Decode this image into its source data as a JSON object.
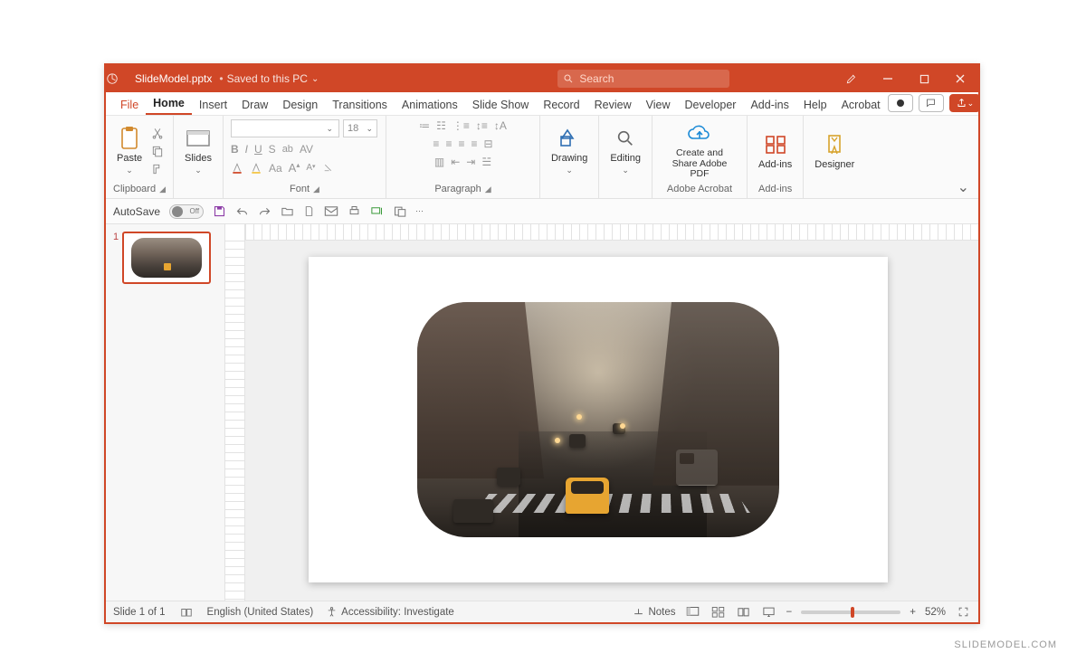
{
  "title": {
    "filename": "SlideModel.pptx",
    "save_state": "Saved to this PC"
  },
  "search": {
    "placeholder": "Search"
  },
  "tabs": {
    "file": "File",
    "home": "Home",
    "insert": "Insert",
    "draw": "Draw",
    "design": "Design",
    "transitions": "Transitions",
    "animations": "Animations",
    "slideshow": "Slide Show",
    "record": "Record",
    "review": "Review",
    "view": "View",
    "developer": "Developer",
    "addins": "Add-ins",
    "help": "Help",
    "acrobat": "Acrobat"
  },
  "ribbon": {
    "clipboard": {
      "paste": "Paste",
      "label": "Clipboard"
    },
    "slides": {
      "btn": "Slides",
      "label": ""
    },
    "font": {
      "size": "18",
      "label": "Font"
    },
    "paragraph": {
      "label": "Paragraph"
    },
    "drawing": {
      "btn": "Drawing",
      "label": ""
    },
    "editing": {
      "btn": "Editing",
      "label": ""
    },
    "acrobat": {
      "btn": "Create and Share Adobe PDF",
      "label": "Adobe Acrobat"
    },
    "addins": {
      "btn": "Add-ins",
      "label": "Add-ins"
    },
    "designer": {
      "btn": "Designer",
      "label": ""
    }
  },
  "qat": {
    "autosave": "AutoSave",
    "autosave_state": "Off"
  },
  "thumbs": {
    "n1": "1"
  },
  "status": {
    "slide": "Slide 1 of 1",
    "lang": "English (United States)",
    "access": "Accessibility: Investigate",
    "notes": "Notes",
    "zoom": "52%"
  },
  "watermark": "SLIDEMODEL.COM"
}
